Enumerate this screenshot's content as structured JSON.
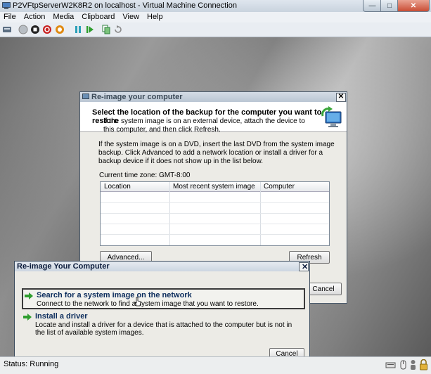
{
  "window": {
    "title": "P2VFtpServerW2K8R2 on localhost - Virtual Machine Connection",
    "minimize_icon": "minimize-icon",
    "maximize_icon": "maximize-icon",
    "close_icon": "close-icon"
  },
  "menu": [
    "File",
    "Action",
    "Media",
    "Clipboard",
    "View",
    "Help"
  ],
  "toolbar": {
    "icons": [
      "ctrl-alt-del-icon",
      "start-icon",
      "turn-off-icon",
      "shut-down-icon",
      "save-state-icon",
      "pause-icon",
      "reset-icon",
      "snapshot-icon",
      "revert-icon"
    ]
  },
  "reimage_dialog": {
    "title": "Re-image your computer",
    "heading": "Select the location of the backup for the computer you want to restore",
    "subtext": "If the system image is on an external device, attach the device to this computer, and then click Refresh.",
    "body": "If the system image is on a DVD, insert the last DVD from the system image backup. Click Advanced to add a network location or install a driver for a backup device if it does not show up in the list below.",
    "timezone": "Current time zone: GMT-8:00",
    "columns": [
      "Location",
      "Most recent system image",
      "Computer"
    ],
    "advanced_label": "Advanced...",
    "refresh_label": "Refresh",
    "cancel_label": "Cancel"
  },
  "advanced_dialog": {
    "title": "Re-image Your Computer",
    "options": [
      {
        "title": "Search for a system image on the network",
        "description": "Connect to the network to find a system image that you want to restore."
      },
      {
        "title": "Install a driver",
        "description": "Locate and install a driver for a device that is attached to the computer but is not in the list of available system images."
      }
    ],
    "cancel_label": "Cancel"
  },
  "status": {
    "text": "Status: Running"
  },
  "colors": {
    "accent_green": "#2f9e2f",
    "link_blue": "#0b2c5c"
  }
}
